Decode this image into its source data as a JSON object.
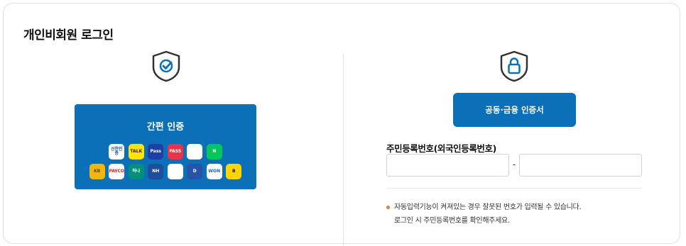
{
  "page": {
    "title": "개인비회원 로그인"
  },
  "simple_auth": {
    "label": "간편 인증",
    "apps": [
      {
        "icon": "shinhan-icon",
        "text": "신한인증",
        "bg": "#ffffff",
        "fg": "#1a4fa0"
      },
      {
        "icon": "kakao-talk-icon",
        "text": "TALK",
        "bg": "#fee500",
        "fg": "#3c1e1e"
      },
      {
        "icon": "samsung-pass-icon",
        "text": "Pass",
        "bg": "#1c3fa8",
        "fg": "#ffffff"
      },
      {
        "icon": "pass-icon",
        "text": "PASS",
        "bg": "#e8334a",
        "fg": "#ffffff"
      },
      {
        "icon": "toss-icon",
        "text": "",
        "bg": "#ffffff",
        "fg": "#1b64da"
      },
      {
        "icon": "naver-icon",
        "text": "N",
        "bg": "#03c75a",
        "fg": "#ffffff"
      },
      {
        "icon": "kb-icon",
        "text": "KB",
        "bg": "#f2b705",
        "fg": "#5a4a2f"
      },
      {
        "icon": "payco-icon",
        "text": "PAYCO",
        "bg": "#ffffff",
        "fg": "#e2231a"
      },
      {
        "icon": "hana-icon",
        "text": "하나",
        "bg": "#009178",
        "fg": "#ffffff"
      },
      {
        "icon": "nh-icon",
        "text": "NH",
        "bg": "#1e4e9c",
        "fg": "#ffffff"
      },
      {
        "icon": "smile-icon",
        "text": "",
        "bg": "#ffffff",
        "fg": "#25b45a"
      },
      {
        "icon": "dream-shield-icon",
        "text": "D",
        "bg": "#2753a8",
        "fg": "#ffffff"
      },
      {
        "icon": "woori-icon",
        "text": "WON",
        "bg": "#ffffff",
        "fg": "#1a5fc8"
      },
      {
        "icon": "banksalad-icon",
        "text": "B",
        "bg": "#ffd400",
        "fg": "#111111"
      }
    ]
  },
  "certificate": {
    "button_label": "공동·금융 인증서"
  },
  "rrn": {
    "label": "주민등록번호(외국인등록번호)",
    "front_value": "",
    "back_value": "",
    "separator": "-"
  },
  "notice": {
    "line1": "자동입력기능이 켜져있는 경우 잘못된 번호가 입력될 수 있습니다.",
    "line2": "로그인 시 주민등록번호를 확인해주세요."
  },
  "colors": {
    "primary": "#0b70b7",
    "bullet": "#e2803a"
  }
}
